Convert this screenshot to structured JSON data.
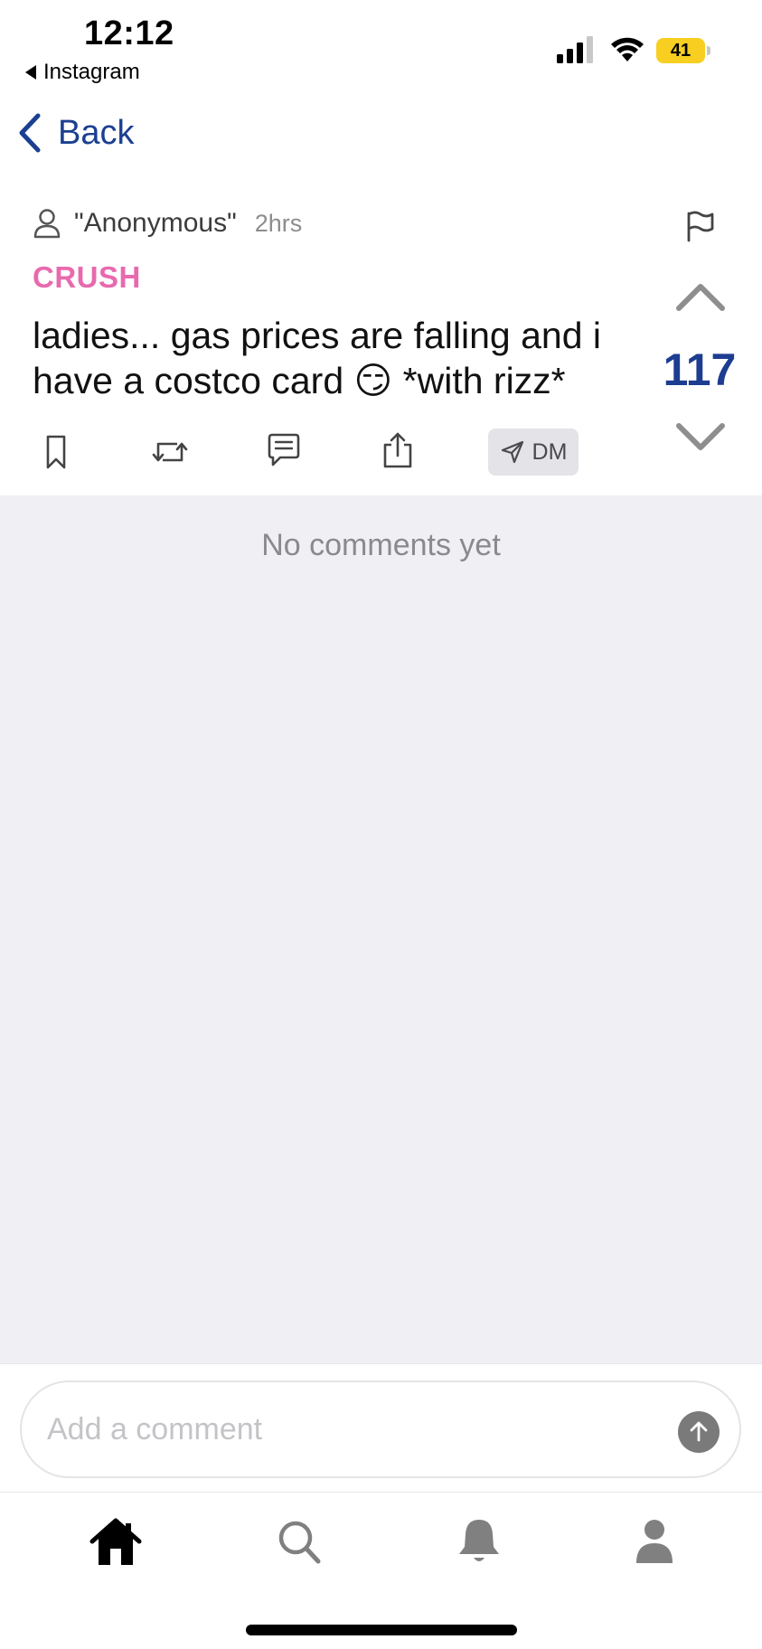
{
  "status_bar": {
    "time": "12:12",
    "back_app_label": "Instagram",
    "battery_level": "41",
    "battery_color": "#f8cf21"
  },
  "nav": {
    "back_label": "Back",
    "accent_color": "#1b3f91"
  },
  "post": {
    "author": "\"Anonymous\"",
    "time_ago": "2hrs",
    "category": "CRUSH",
    "category_color": "#e86aae",
    "text": "ladies... gas prices are falling and i have a costco card 😏  *with rizz*",
    "vote_count": "117",
    "dm_label": "DM",
    "action_icons": [
      "bookmark-icon",
      "repost-icon",
      "comment-icon",
      "share-icon",
      "send-icon"
    ]
  },
  "comments": {
    "empty_text": "No comments yet"
  },
  "comment_bar": {
    "placeholder": "Add a comment"
  },
  "tab_bar": {
    "tabs": [
      "home-icon",
      "search-icon",
      "bell-icon",
      "profile-icon"
    ],
    "active_tab": "home-icon"
  }
}
